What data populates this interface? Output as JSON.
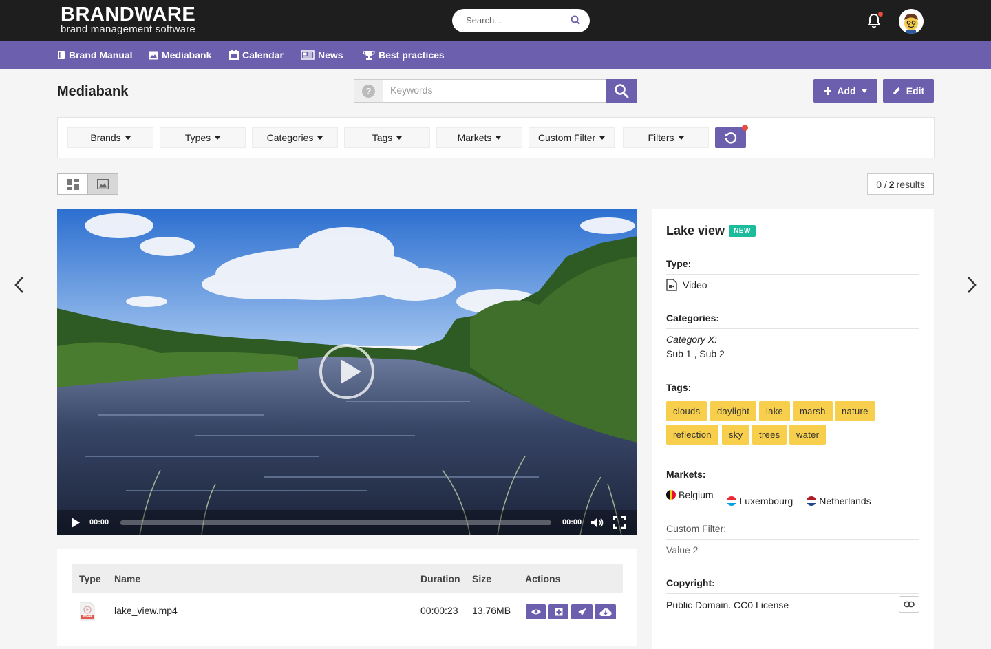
{
  "brand": {
    "name": "BRANDWARE",
    "tagline": "brand management software"
  },
  "top_search": {
    "placeholder": "Search..."
  },
  "nav": {
    "items": [
      {
        "label": "Brand Manual",
        "icon": "book-icon"
      },
      {
        "label": "Mediabank",
        "icon": "image-icon"
      },
      {
        "label": "Calendar",
        "icon": "calendar-icon"
      },
      {
        "label": "News",
        "icon": "newspaper-icon"
      },
      {
        "label": "Best practices",
        "icon": "trophy-icon"
      }
    ]
  },
  "page": {
    "title": "Mediabank"
  },
  "keywords": {
    "placeholder": "Keywords",
    "help": "?"
  },
  "actions": {
    "add_label": "Add",
    "edit_label": "Edit"
  },
  "filters": [
    "Brands",
    "Types",
    "Categories",
    "Tags",
    "Markets",
    "Custom Filter",
    "Filters"
  ],
  "results": {
    "selected": "0",
    "total": "2",
    "label": "results"
  },
  "player": {
    "current_time": "00:00",
    "total_time": "00:00"
  },
  "detail": {
    "title": "Lake view",
    "badge": "NEW",
    "type_label": "Type:",
    "type_value": "Video",
    "categories_label": "Categories:",
    "category_name": "Category X:",
    "category_subs": "Sub 1 , Sub 2",
    "tags_label": "Tags:",
    "tags": [
      "clouds",
      "daylight",
      "lake",
      "marsh",
      "nature",
      "reflection",
      "sky",
      "trees",
      "water"
    ],
    "markets_label": "Markets:",
    "markets": [
      "Belgium",
      "Luxembourg",
      "Netherlands"
    ],
    "custom_filter_label": "Custom Filter:",
    "custom_filter_value": "Value 2",
    "copyright_label": "Copyright:",
    "copyright_value": "Public Domain. CC0 License"
  },
  "table": {
    "headers": {
      "type": "Type",
      "name": "Name",
      "duration": "Duration",
      "size": "Size",
      "actions": "Actions"
    },
    "rows": [
      {
        "type": "MP4",
        "name": "lake_view.mp4",
        "duration": "00:00:23",
        "size": "13.76MB"
      }
    ]
  },
  "colors": {
    "accent": "#6b5fae",
    "topbar": "#1e1e1e",
    "tag": "#f7cf4d",
    "badge": "#1bbc9b"
  }
}
